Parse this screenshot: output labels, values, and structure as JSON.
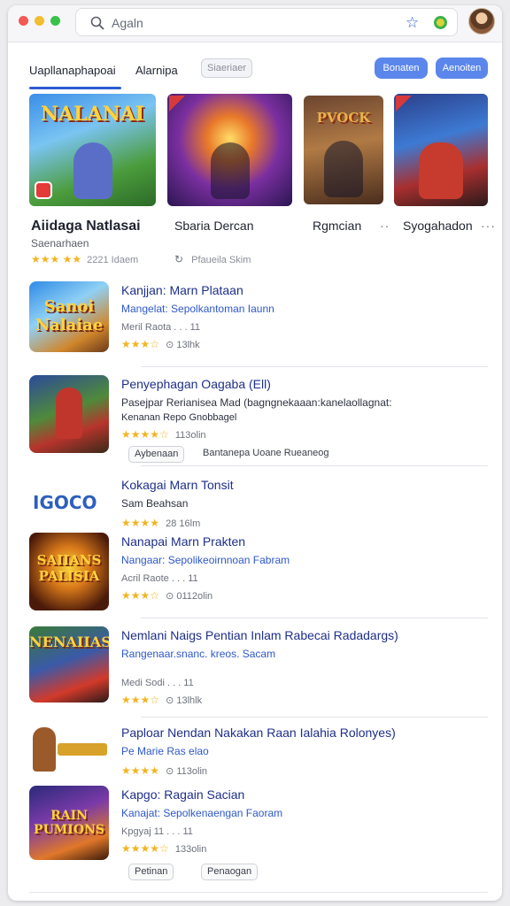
{
  "browser": {
    "search_query": "Agaln"
  },
  "tabs": {
    "tab1_label": "Uapllanaphapoai",
    "tab2_label": "Alarnipa",
    "search_chip": "Siaeriaer",
    "button1_label": "Bonaten",
    "button2_label": "Aenoiten"
  },
  "featured": [
    {
      "title": "Aiidaga Natlasai",
      "art_text": "NALANAI",
      "subtitle": "Saenarhaen",
      "meta": "2221 Idaem"
    },
    {
      "title": "Sbaria Dercan",
      "art_text": "",
      "subtitle": "",
      "meta": "Pfaueila Skim"
    },
    {
      "title": "Rgmcian",
      "art_text": "PVOCK",
      "subtitle": "",
      "meta": ""
    },
    {
      "title": "Syogahadon",
      "art_text": "",
      "subtitle": "",
      "meta": ""
    }
  ],
  "list": [
    {
      "title": "Kanjjan: Marn Plataan",
      "art_text": "Sanoi Nalaiae",
      "sub": "Mangelat: Sepolkantoman Iaunn",
      "line3": "Meril Raota  .  .  .  11",
      "meta": "13lhk"
    },
    {
      "title": "Penyephagan Oagaba (Ell)",
      "art_text": "",
      "sub": "Pasejpar Rerianisea Mad (bagngnekaaan:kanelaollagnat:",
      "line3": "Kenanan Repo Gnobbagel",
      "meta": "113olin",
      "pill1": "Aybenaan",
      "pill2": "Bantanepa Uoane Rueaneog"
    },
    {
      "title": "Kokagai Marn Tonsit",
      "art_text": "IGOCO",
      "sub": "Sam Beahsan",
      "line3": "",
      "meta": "28 16lm"
    },
    {
      "title": "Nanapai Marn Prakten",
      "art_text": "SAIIANS PALISIA",
      "sub": "Nangaar: Sepolikeoirnnoan Fabram",
      "line3": "Acril Raote  .  .  .  11",
      "meta": "0112olin"
    },
    {
      "title": "Nemlani Naigs Pentian Inlam Rabecai Radadargs)",
      "art_text": "NENAIIAS",
      "sub": "Rangenaar.snanc. kreos. Sacam",
      "line3": "Medi Sodi  .  .  .  11",
      "meta": "13lhlk"
    },
    {
      "title": "Paploar Nendan Nakakan Raan Ialahia Rolonyes)",
      "art_text": "",
      "sub": "Pe Marie Ras elao",
      "line3": "",
      "meta": "113olin"
    },
    {
      "title": "Kapgo: Ragain Sacian",
      "art_text": "RAIN PUMIONS",
      "sub": "Kanajat: Sepolkenaengan Faoram",
      "line3": "Kpgyaj 11  .  .  .  11",
      "meta": "133olin",
      "pill1": "Petinan",
      "pill2": "Penaogan"
    }
  ],
  "colors": {
    "accent": "#2d5bd4",
    "link": "#1e2f8a",
    "star": "#f2b422",
    "button": "#5b87ec"
  }
}
